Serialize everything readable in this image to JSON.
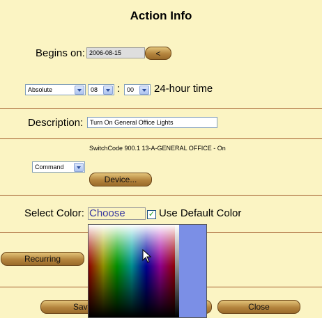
{
  "title": "Action Info",
  "begins": {
    "label": "Begins on:",
    "date": "2006-08-15",
    "nav_button": "<"
  },
  "time": {
    "mode": "Absolute",
    "hour": "08",
    "separator": ":",
    "minute": "00",
    "suffix": "24-hour time"
  },
  "description": {
    "label": "Description:",
    "value": "Turn On General Office Lights"
  },
  "command": {
    "summary": "SwitchCode 900.1 13-A-GENERAL OFFICE -  On",
    "type": "Command",
    "device_button": "Device..."
  },
  "color": {
    "label": "Select Color:",
    "choose_value": "Choose",
    "use_default_label": "Use Default Color",
    "use_default_checked": true,
    "checkmark": "✓",
    "selected_preview": "#7b8fe6"
  },
  "buttons": {
    "recurring": "Recurring",
    "save": "Save",
    "close": "Close"
  }
}
